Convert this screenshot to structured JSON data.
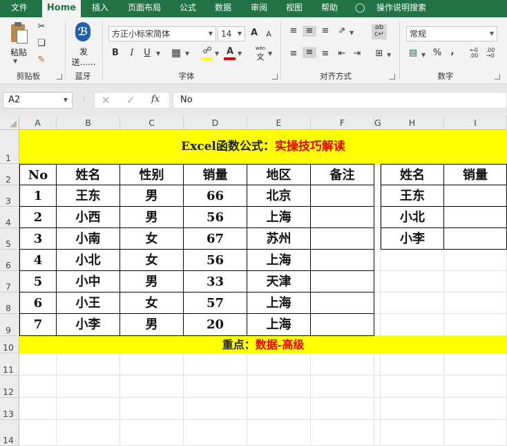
{
  "tabs": [
    "文件",
    "Home",
    "插入",
    "页面布局",
    "公式",
    "数据",
    "审阅",
    "视图",
    "帮助",
    "操作说明搜索"
  ],
  "clipboard": {
    "paste": "粘贴",
    "label": "剪贴板"
  },
  "bluetooth": {
    "send": "发",
    "send2": "送......",
    "label": "蓝牙"
  },
  "font": {
    "name": "方正小标宋简体",
    "size": "14",
    "bold": "B",
    "italic": "I",
    "underline": "U",
    "grow": "A",
    "shrink": "A",
    "fontcolor": "A",
    "wen": "wén",
    "wen2": "文",
    "label": "字体"
  },
  "align": {
    "label": "对齐方式"
  },
  "number": {
    "format": "常规",
    "percent": "%",
    "comma": ",",
    "label": "数字"
  },
  "namebox": "A2",
  "formula": "No",
  "columns": [
    "A",
    "B",
    "C",
    "D",
    "E",
    "F",
    "G",
    "H",
    "I"
  ],
  "rows": [
    "1",
    "2",
    "3",
    "4",
    "5",
    "6",
    "7",
    "8",
    "9",
    "10",
    "11",
    "12",
    "13",
    "14"
  ],
  "title": {
    "black": "Excel函数公式：",
    "red": "实操技巧解读"
  },
  "headers": [
    "No",
    "姓名",
    "性别",
    "销量",
    "地区",
    "备注"
  ],
  "data": [
    [
      "1",
      "王东",
      "男",
      "66",
      "北京",
      ""
    ],
    [
      "2",
      "小西",
      "男",
      "56",
      "上海",
      ""
    ],
    [
      "3",
      "小南",
      "女",
      "67",
      "苏州",
      ""
    ],
    [
      "4",
      "小北",
      "女",
      "56",
      "上海",
      ""
    ],
    [
      "5",
      "小中",
      "男",
      "33",
      "天津",
      ""
    ],
    [
      "6",
      "小王",
      "女",
      "57",
      "上海",
      ""
    ],
    [
      "7",
      "小李",
      "男",
      "20",
      "上海",
      ""
    ]
  ],
  "side_headers": [
    "姓名",
    "销量"
  ],
  "side_data": [
    [
      "王东",
      ""
    ],
    [
      "小北",
      ""
    ],
    [
      "小李",
      ""
    ]
  ],
  "footer": {
    "black": "重点：",
    "red": "数据-高级"
  },
  "colors": {
    "green": "#217346",
    "yellow": "#ffff00",
    "red": "#e60000"
  }
}
